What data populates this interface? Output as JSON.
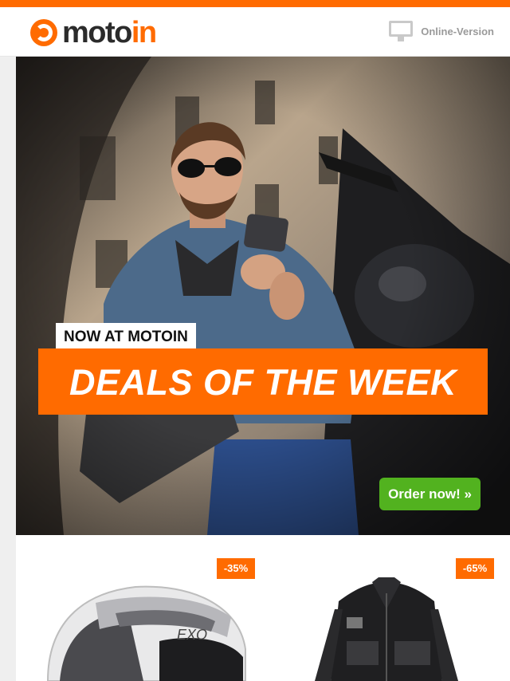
{
  "header": {
    "logo_part1": "moto",
    "logo_part2": "in",
    "online_version_label": "Online-Version"
  },
  "hero": {
    "tag": "NOW AT MOTOIN",
    "headline": "DEALS OF THE WEEK",
    "cta": "Order now! »"
  },
  "products": [
    {
      "discount": "-35%",
      "item": "helmet"
    },
    {
      "discount": "-65%",
      "item": "jacket"
    }
  ],
  "colors": {
    "brand_orange": "#ff6b00",
    "cta_green": "#52b21f"
  }
}
